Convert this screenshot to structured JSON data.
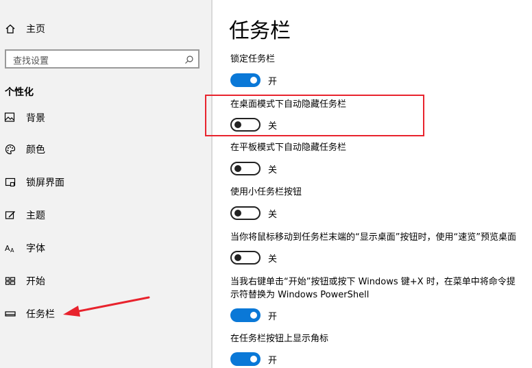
{
  "sidebar": {
    "home_label": "主页",
    "search_placeholder": "查找设置",
    "section_title": "个性化",
    "items": [
      {
        "label": "背景",
        "icon": "picture-icon"
      },
      {
        "label": "颜色",
        "icon": "palette-icon"
      },
      {
        "label": "锁屏界面",
        "icon": "lock-screen-icon"
      },
      {
        "label": "主题",
        "icon": "theme-icon"
      },
      {
        "label": "字体",
        "icon": "font-icon"
      },
      {
        "label": "开始",
        "icon": "start-icon"
      },
      {
        "label": "任务栏",
        "icon": "taskbar-icon"
      }
    ]
  },
  "main": {
    "title": "任务栏",
    "settings": [
      {
        "label": "锁定任务栏",
        "state": "开",
        "on": true
      },
      {
        "label": "在桌面模式下自动隐藏任务栏",
        "state": "关",
        "on": false
      },
      {
        "label": "在平板模式下自动隐藏任务栏",
        "state": "关",
        "on": false
      },
      {
        "label": "使用小任务栏按钮",
        "state": "关",
        "on": false
      },
      {
        "label": "当你将鼠标移动到任务栏末端的“显示桌面”按钮时，使用“速览”预览桌面",
        "state": "关",
        "on": false
      },
      {
        "label_line1": "当我右键单击“开始”按钮或按下 Windows 键+X 时，在菜单中将命令提",
        "label_line2": "示符替换为 Windows PowerShell",
        "state": "开",
        "on": true
      },
      {
        "label": "在任务栏按钮上显示角标",
        "state": "开",
        "on": true
      }
    ]
  },
  "colors": {
    "accent": "#0a78d7",
    "annotation": "#e8232d",
    "sidebar_bg": "#f2f2f2"
  }
}
